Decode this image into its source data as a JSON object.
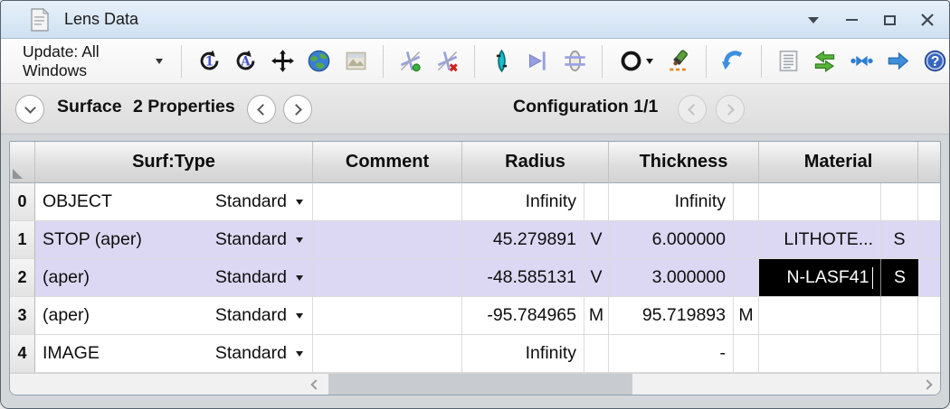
{
  "window": {
    "title": "Lens Data"
  },
  "toolbar": {
    "update_label": "Update: All Windows",
    "icons": [
      "update-1-icon",
      "update-all-icon",
      "pan-icon",
      "globe-icon",
      "image-icon",
      "insert-surface-icon",
      "delete-surface-icon",
      "insert-stop-icon",
      "aperture-arrow-icon",
      "lens-lines-icon",
      "circle-dropdown-icon",
      "flashlight-icon",
      "undo-arrow-icon",
      "list-icon",
      "swap-arrows-icon",
      "converge-arrows-icon",
      "next-arrow-icon",
      "help-icon"
    ]
  },
  "glyphs": {
    "update_one": "1",
    "update_all": "A",
    "help_question_mark": "?"
  },
  "navbar": {
    "surface_word": "Surface",
    "surface_properties": "2 Properties",
    "configuration": "Configuration 1/1"
  },
  "table": {
    "headers": [
      "Surf:Type",
      "Comment",
      "Radius",
      "Thickness",
      "Material"
    ],
    "rows": [
      {
        "num": "0",
        "label": "OBJECT",
        "type": "Standard",
        "comment": "",
        "radius": "Infinity",
        "radius_flag": "",
        "thickness": "Infinity",
        "thickness_flag": "",
        "material": "",
        "material_flag": ""
      },
      {
        "num": "1",
        "label": "STOP (aper)",
        "type": "Standard",
        "comment": "",
        "radius": "45.279891",
        "radius_flag": "V",
        "thickness": "6.000000",
        "thickness_flag": "",
        "material": "LITHOTE...",
        "material_flag": "S"
      },
      {
        "num": "2",
        "label": "(aper)",
        "type": "Standard",
        "comment": "",
        "radius": "-48.585131",
        "radius_flag": "V",
        "thickness": "3.000000",
        "thickness_flag": "",
        "material": "N-LASF41",
        "material_flag": "S"
      },
      {
        "num": "3",
        "label": "(aper)",
        "type": "Standard",
        "comment": "",
        "radius": "-95.784965",
        "radius_flag": "M",
        "thickness": "95.719893",
        "thickness_flag": "M",
        "material": "",
        "material_flag": ""
      },
      {
        "num": "4",
        "label": "IMAGE",
        "type": "Standard",
        "comment": "",
        "radius": "Infinity",
        "radius_flag": "",
        "thickness": "-",
        "thickness_flag": "",
        "material": "",
        "material_flag": ""
      }
    ]
  }
}
